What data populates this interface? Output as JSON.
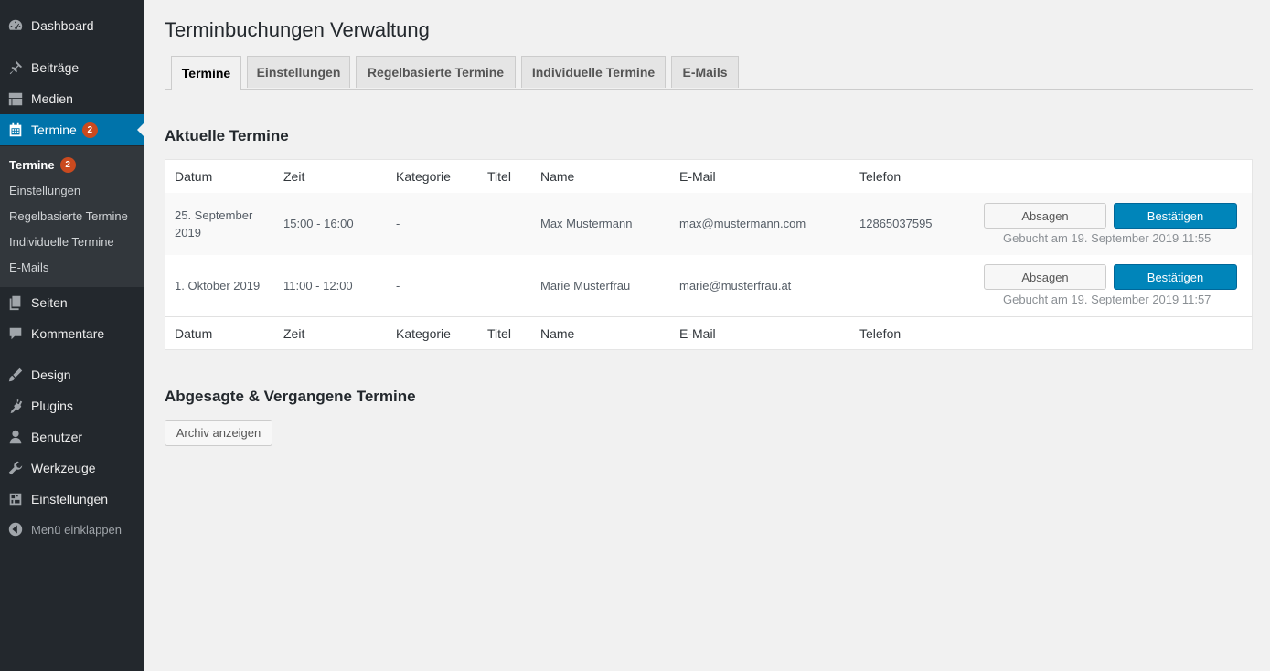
{
  "sidebar": {
    "items": [
      {
        "label": "Dashboard",
        "icon": "dashboard-icon"
      },
      {
        "label": "Beiträge",
        "icon": "pin-icon"
      },
      {
        "label": "Medien",
        "icon": "media-icon"
      },
      {
        "label": "Termine",
        "icon": "calendar-icon",
        "badge": "2",
        "active": true
      },
      {
        "label": "Seiten",
        "icon": "pages-icon"
      },
      {
        "label": "Kommentare",
        "icon": "comment-icon"
      },
      {
        "label": "Design",
        "icon": "brush-icon"
      },
      {
        "label": "Plugins",
        "icon": "plugin-icon"
      },
      {
        "label": "Benutzer",
        "icon": "user-icon"
      },
      {
        "label": "Werkzeuge",
        "icon": "wrench-icon"
      },
      {
        "label": "Einstellungen",
        "icon": "settings-icon"
      }
    ],
    "submenu": [
      {
        "label": "Termine",
        "badge": "2",
        "current": true
      },
      {
        "label": "Einstellungen"
      },
      {
        "label": "Regelbasierte Termine"
      },
      {
        "label": "Individuelle Termine"
      },
      {
        "label": "E-Mails"
      }
    ],
    "collapse_label": "Menü einklappen",
    "accent_color": "#0073aa",
    "badge_color": "#ca4a1f"
  },
  "page": {
    "title": "Terminbuchungen Verwaltung",
    "tabs": [
      "Termine",
      "Einstellungen",
      "Regelbasierte Termine",
      "Individuelle Termine",
      "E-Mails"
    ],
    "active_tab": "Termine"
  },
  "current": {
    "heading": "Aktuelle Termine",
    "columns": [
      "Datum",
      "Zeit",
      "Kategorie",
      "Titel",
      "Name",
      "E-Mail",
      "Telefon"
    ],
    "rows": [
      {
        "date_line1": "25. September",
        "date_line2": "2019",
        "time": "15:00 - 16:00",
        "category": "-",
        "title": "",
        "name": "Max Mustermann",
        "email": "max@mustermann.com",
        "phone": "12865037595",
        "booked": "Gebucht am 19. September 2019 11:55"
      },
      {
        "date_line1": "1. Oktober 2019",
        "date_line2": "",
        "time": "11:00 - 12:00",
        "category": "-",
        "title": "",
        "name": "Marie Musterfrau",
        "email": "marie@musterfrau.at",
        "phone": "",
        "booked": "Gebucht am 19. September 2019 11:57"
      }
    ],
    "cancel_label": "Absagen",
    "confirm_label": "Bestätigen"
  },
  "past": {
    "heading": "Abgesagte & Vergangene Termine",
    "archive_label": "Archiv anzeigen"
  }
}
